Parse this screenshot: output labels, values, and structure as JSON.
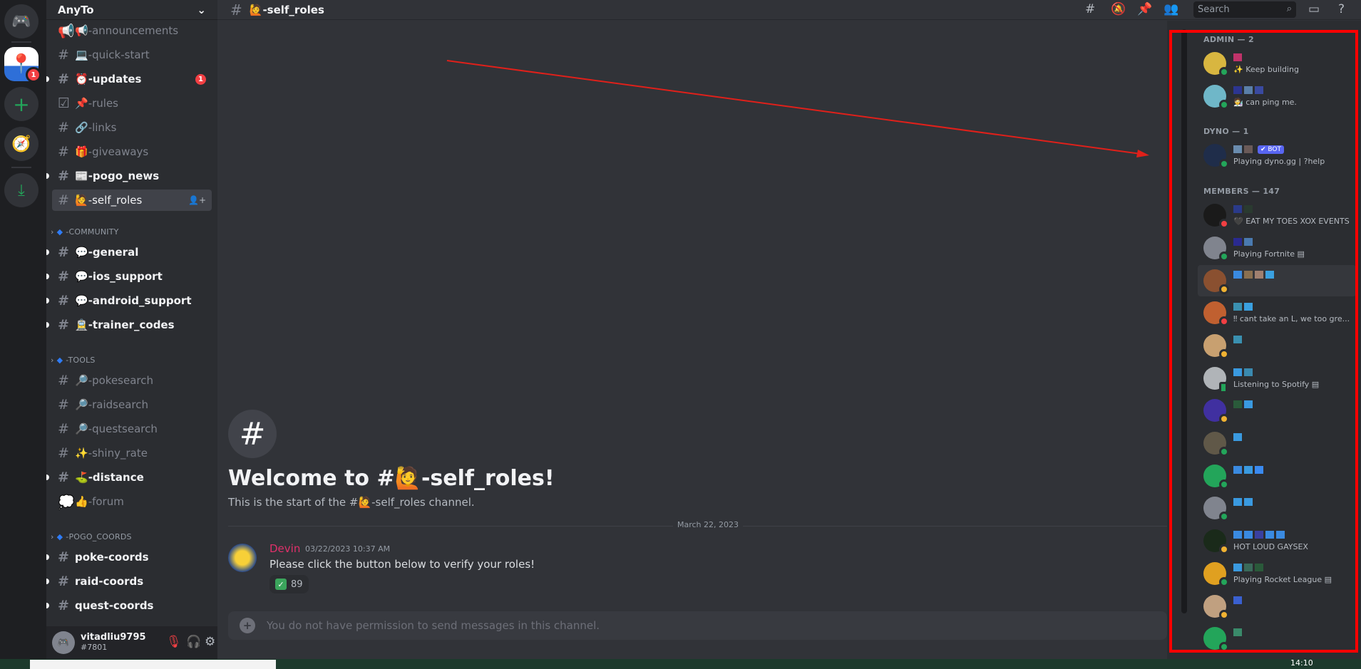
{
  "rail": {
    "home_icon": "discord-icon",
    "server_badge": "1",
    "add_icon": "plus-icon",
    "explore_icon": "compass-icon",
    "download_icon": "download-icon"
  },
  "server": {
    "name": "AnyTo"
  },
  "channels": [
    {
      "emoji": "📢",
      "name": "-announcements",
      "type": "announcement",
      "unread": false
    },
    {
      "emoji": "💻",
      "name": "-quick-start",
      "type": "text",
      "unread": false
    },
    {
      "emoji": "⏰",
      "name": "-updates",
      "type": "text",
      "unread": true,
      "mentions": "1"
    },
    {
      "emoji": "📌",
      "name": "-rules",
      "type": "rules",
      "unread": false
    },
    {
      "emoji": "🔗",
      "name": "-links",
      "type": "text",
      "unread": false
    },
    {
      "emoji": "🎁",
      "name": "-giveaways",
      "type": "text",
      "unread": false
    },
    {
      "emoji": "📰",
      "name": "-pogo_news",
      "type": "text",
      "unread": true
    },
    {
      "emoji": "🙋",
      "name": "-self_roles",
      "type": "text",
      "active": true
    }
  ],
  "categories": [
    {
      "name": "-COMMUNITY",
      "channels": [
        {
          "emoji": "💬",
          "name": "-general",
          "unread": true
        },
        {
          "emoji": "💬",
          "name": "-ios_support",
          "unread": true
        },
        {
          "emoji": "💬",
          "name": "-android_support",
          "unread": true
        },
        {
          "emoji": "🚊",
          "name": "-trainer_codes",
          "unread": true
        }
      ]
    },
    {
      "name": "-TOOLS",
      "channels": [
        {
          "emoji": "🔎",
          "name": "-pokesearch",
          "unread": false,
          "type": "thread"
        },
        {
          "emoji": "🔎",
          "name": "-raidsearch",
          "unread": false
        },
        {
          "emoji": "🔎",
          "name": "-questsearch",
          "unread": false,
          "type": "thread"
        },
        {
          "emoji": "✨",
          "name": "-shiny_rate",
          "unread": false
        },
        {
          "emoji": "⛳",
          "name": "-distance",
          "unread": true
        },
        {
          "emoji": "👍",
          "name": "-forum",
          "unread": false,
          "type": "forum"
        }
      ]
    },
    {
      "name": "-POGO_COORDS",
      "channels": [
        {
          "emoji": "",
          "name": "poke-coords",
          "unread": true
        },
        {
          "emoji": "",
          "name": "raid-coords",
          "unread": true
        },
        {
          "emoji": "",
          "name": "quest-coords",
          "unread": true
        }
      ]
    }
  ],
  "user": {
    "name": "vitadliu9795",
    "tag": "#7801"
  },
  "header": {
    "channel": "🙋-self_roles",
    "search_placeholder": "Search"
  },
  "welcome": {
    "title": "Welcome to #🙋-self_roles!",
    "subtitle": "This is the start of the #🙋-self_roles channel."
  },
  "date_divider": "March 22, 2023",
  "message": {
    "author": "Devin",
    "author_color": "#e0306a",
    "timestamp": "03/22/2023 10:37 AM",
    "text": "Please click the button below to verify your roles!",
    "reaction_emoji": "✓",
    "reaction_count": "89"
  },
  "input_placeholder": "You do not have permission to send messages in this channel.",
  "member_groups": [
    {
      "label": "ADMIN — 2",
      "members": [
        {
          "status": "✨ Keep building",
          "presence": "online",
          "avatar": "#d8b640",
          "names": [
            "#c0336a"
          ]
        },
        {
          "status": "🧑‍🔬 can ping me.",
          "presence": "online",
          "avatar": "#6fb7c8",
          "names": [
            "#2c3590",
            "#5a7fa8",
            "#3a4aa0"
          ]
        }
      ]
    },
    {
      "label": "DYNO — 1",
      "members": [
        {
          "status": "Playing dyno.gg | ?help",
          "presence": "online",
          "avatar": "#1f2d4a",
          "names": [
            "#6a8cae",
            "#6a5a58"
          ],
          "bot_label": "✔ BOT"
        }
      ]
    },
    {
      "label": "MEMBERS — 147",
      "members": [
        {
          "status": "🖤 EAT MY TOES XOX EVENTS",
          "presence": "dnd",
          "avatar": "#1a1a1a",
          "names": [
            "#2a3a8a",
            "#2a3a30"
          ]
        },
        {
          "status": "Playing Fortnite ▤",
          "presence": "online",
          "avatar": "#80848e",
          "names": [
            "#2a2a90",
            "#4a7ab0"
          ]
        },
        {
          "status": "",
          "presence": "idle",
          "avatar": "#8a5030",
          "names": [
            "#3a8ae0",
            "#8a7050",
            "#a08070",
            "#3aa0e0"
          ],
          "highlight": true
        },
        {
          "status": "‼ cant take an L, we too gre...",
          "presence": "dnd",
          "avatar": "#c06030",
          "names": [
            "#3a90b0",
            "#3aa0e0"
          ]
        },
        {
          "status": "",
          "presence": "idle",
          "avatar": "#c8a070",
          "names": [
            "#3a90b0"
          ]
        },
        {
          "status": "Listening to Spotify ▤",
          "presence": "mobile",
          "avatar": "#b0b4b8",
          "names": [
            "#3a9ae0",
            "#3a8ab0"
          ]
        },
        {
          "status": "",
          "presence": "idle",
          "avatar": "#4030a0",
          "names": [
            "#2a5a3a",
            "#3a9ae0"
          ]
        },
        {
          "status": "",
          "presence": "online",
          "avatar": "#605848",
          "names": [
            "#3a9ae0"
          ]
        },
        {
          "status": "",
          "presence": "online",
          "avatar": "#23a55a",
          "names": [
            "#3a8ae0",
            "#3a9ae0",
            "#3a8af0"
          ]
        },
        {
          "status": "",
          "presence": "online",
          "avatar": "#80848e",
          "names": [
            "#3a9ae0",
            "#3a9ae0"
          ]
        },
        {
          "status": "HOT LOUD GAYSEX",
          "presence": "idle",
          "avatar": "#1a2a1a",
          "names": [
            "#3a8ae0",
            "#3a8ae0",
            "#3a40a0",
            "#3a8ae0",
            "#3a8ae0"
          ]
        },
        {
          "status": "Playing Rocket League ▤",
          "presence": "online",
          "avatar": "#e0a020",
          "names": [
            "#3a9ae0",
            "#3a6a5a",
            "#2a5a3a"
          ]
        },
        {
          "status": "",
          "presence": "idle",
          "avatar": "#c0a080",
          "names": [
            "#3a60d0"
          ]
        },
        {
          "status": "",
          "presence": "online",
          "avatar": "#23a55a",
          "names": [
            "#3a8a6a"
          ]
        }
      ]
    }
  ],
  "taskbar": {
    "time": "14:10"
  },
  "colors": {
    "annotation": "#ff0000",
    "online": "#23a55a",
    "idle": "#f0b232",
    "dnd": "#f23f43"
  }
}
